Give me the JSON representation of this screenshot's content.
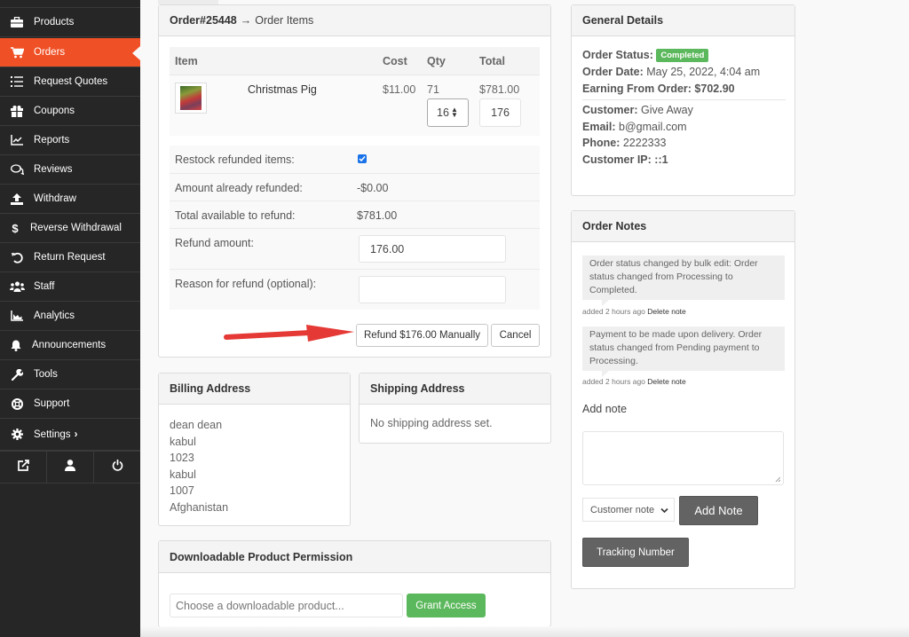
{
  "sidebar": {
    "items": [
      {
        "label": "Products",
        "icon": "briefcase-icon"
      },
      {
        "label": "Orders",
        "icon": "cart-icon",
        "active": true
      },
      {
        "label": "Request Quotes",
        "icon": "list-icon"
      },
      {
        "label": "Coupons",
        "icon": "gift-icon"
      },
      {
        "label": "Reports",
        "icon": "chart-line-icon"
      },
      {
        "label": "Reviews",
        "icon": "comments-icon"
      },
      {
        "label": "Withdraw",
        "icon": "upload-icon"
      },
      {
        "label": "Reverse Withdrawal",
        "icon": "dollar-icon"
      },
      {
        "label": "Return Request",
        "icon": "undo-icon"
      },
      {
        "label": "Staff",
        "icon": "users-icon"
      },
      {
        "label": "Analytics",
        "icon": "area-chart-icon"
      },
      {
        "label": "Announcements",
        "icon": "bell-icon"
      },
      {
        "label": "Tools",
        "icon": "wrench-icon"
      },
      {
        "label": "Support",
        "icon": "lifebuoy-icon"
      },
      {
        "label": "Settings",
        "icon": "gear-icon",
        "suffix": "›"
      }
    ],
    "bottom": [
      "external-link-icon",
      "user-icon",
      "power-icon"
    ]
  },
  "order_items": {
    "title": "Order#25448",
    "arrow": "→",
    "subtitle": "Order Items",
    "columns": [
      "Item",
      "Cost",
      "Qty",
      "Total"
    ],
    "rows": [
      {
        "name": "Christmas Pig",
        "cost": "$11.00",
        "qty": "71",
        "total": "$781.00",
        "refund_qty": "16",
        "refund_total": "176"
      }
    ],
    "refund": {
      "restock_label": "Restock refunded items:",
      "restock_checked": true,
      "already_label": "Amount already refunded:",
      "already_value": "-$0.00",
      "available_label": "Total available to refund:",
      "available_value": "$781.00",
      "amount_label": "Refund amount:",
      "amount_value": "176.00",
      "reason_label": "Reason for refund (optional):",
      "reason_value": ""
    },
    "refund_button": "Refund $176.00 Manually",
    "cancel_button": "Cancel"
  },
  "billing": {
    "title": "Billing Address",
    "lines": [
      "dean dean",
      "kabul",
      "1023",
      "kabul",
      "1007",
      "Afghanistan"
    ]
  },
  "shipping": {
    "title": "Shipping Address",
    "text": "No shipping address set."
  },
  "downloadable": {
    "title": "Downloadable Product Permission",
    "placeholder": "Choose a downloadable product...",
    "button": "Grant Access"
  },
  "general": {
    "title": "General Details",
    "status_label": "Order Status:",
    "status_value": "Completed",
    "date_label": "Order Date:",
    "date_value": "May 25, 2022, 4:04 am",
    "earning_label": "Earning From Order:",
    "earning_value": "$702.90",
    "customer_label": "Customer:",
    "customer_value": "Give Away",
    "email_label": "Email:",
    "email_value": "b@gmail.com",
    "phone_label": "Phone:",
    "phone_value": "2222333",
    "ip_label": "Customer IP:",
    "ip_value": "::1"
  },
  "notes": {
    "title": "Order Notes",
    "items": [
      {
        "text": "Order status changed by bulk edit: Order status changed from Processing to Completed.",
        "meta": "added 2 hours ago",
        "delete": "Delete note"
      },
      {
        "text": "Payment to be made upon delivery. Order status changed from Pending payment to Processing.",
        "meta": "added 2 hours ago",
        "delete": "Delete note"
      }
    ],
    "add_note_label": "Add note",
    "note_type": "Customer note",
    "add_button": "Add Note",
    "tracking_button": "Tracking Number"
  },
  "colors": {
    "sidebar_bg": "#262626",
    "active": "#f05025",
    "success": "#5cb85c",
    "annotation_arrow": "#e53935"
  }
}
